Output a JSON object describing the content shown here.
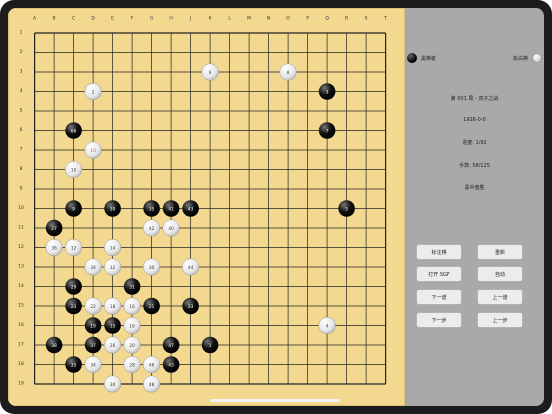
{
  "board": {
    "size": 19,
    "columns": [
      "A",
      "B",
      "C",
      "D",
      "E",
      "F",
      "G",
      "H",
      "J",
      "K",
      "L",
      "M",
      "N",
      "O",
      "P",
      "Q",
      "R",
      "S",
      "T"
    ],
    "rows": [
      "1",
      "2",
      "3",
      "4",
      "5",
      "6",
      "7",
      "8",
      "9",
      "10",
      "11",
      "12",
      "13",
      "14",
      "15",
      "16",
      "17",
      "18",
      "19"
    ],
    "stones": [
      {
        "color": "white",
        "col": 10,
        "row": 3,
        "label": "6"
      },
      {
        "color": "white",
        "col": 14,
        "row": 3,
        "label": "8"
      },
      {
        "color": "white",
        "col": 4,
        "row": 4,
        "label": "2"
      },
      {
        "color": "black",
        "col": 16,
        "row": 4,
        "label": "3"
      },
      {
        "color": "black",
        "col": 3,
        "row": 6,
        "label": "66"
      },
      {
        "color": "black",
        "col": 16,
        "row": 6,
        "label": "7"
      },
      {
        "color": "white",
        "col": 4,
        "row": 7,
        "label": "10",
        "label_color": "#e05050"
      },
      {
        "color": "white",
        "col": 3,
        "row": 8,
        "label": "10"
      },
      {
        "color": "black",
        "col": 3,
        "row": 10,
        "label": "9"
      },
      {
        "color": "black",
        "col": 5,
        "row": 10,
        "label": "39"
      },
      {
        "color": "black",
        "col": 7,
        "row": 10,
        "label": "35"
      },
      {
        "color": "black",
        "col": 8,
        "row": 10,
        "label": "41"
      },
      {
        "color": "black",
        "col": 9,
        "row": 10,
        "label": "43"
      },
      {
        "color": "black",
        "col": 17,
        "row": 10,
        "label": "5"
      },
      {
        "color": "black",
        "col": 2,
        "row": 11,
        "label": "27"
      },
      {
        "color": "white",
        "col": 7,
        "row": 11,
        "label": "42"
      },
      {
        "color": "white",
        "col": 8,
        "row": 11,
        "label": "40"
      },
      {
        "color": "white",
        "col": 2,
        "row": 12,
        "label": "36"
      },
      {
        "color": "white",
        "col": 3,
        "row": 12,
        "label": "12"
      },
      {
        "color": "white",
        "col": 5,
        "row": 12,
        "label": "14"
      },
      {
        "color": "white",
        "col": 4,
        "row": 13,
        "label": "34"
      },
      {
        "color": "white",
        "col": 5,
        "row": 13,
        "label": "32"
      },
      {
        "color": "white",
        "col": 7,
        "row": 13,
        "label": "30"
      },
      {
        "color": "white",
        "col": 9,
        "row": 13,
        "label": "44"
      },
      {
        "color": "black",
        "col": 3,
        "row": 14,
        "label": "29"
      },
      {
        "color": "black",
        "col": 6,
        "row": 14,
        "label": "31"
      },
      {
        "color": "black",
        "col": 3,
        "row": 15,
        "label": "23"
      },
      {
        "color": "white",
        "col": 4,
        "row": 15,
        "label": "22"
      },
      {
        "color": "white",
        "col": 5,
        "row": 15,
        "label": "18"
      },
      {
        "color": "white",
        "col": 6,
        "row": 15,
        "label": "16"
      },
      {
        "color": "black",
        "col": 7,
        "row": 15,
        "label": "21"
      },
      {
        "color": "black",
        "col": 9,
        "row": 15,
        "label": "33"
      },
      {
        "color": "black",
        "col": 4,
        "row": 16,
        "label": "19"
      },
      {
        "color": "black",
        "col": 5,
        "row": 16,
        "label": "15"
      },
      {
        "color": "white",
        "col": 6,
        "row": 16,
        "label": "16"
      },
      {
        "color": "white",
        "col": 16,
        "row": 16,
        "label": "4"
      },
      {
        "color": "black",
        "col": 2,
        "row": 17,
        "label": "38"
      },
      {
        "color": "black",
        "col": 4,
        "row": 17,
        "label": "37"
      },
      {
        "color": "white",
        "col": 5,
        "row": 17,
        "label": "26"
      },
      {
        "color": "white",
        "col": 6,
        "row": 17,
        "label": "20"
      },
      {
        "color": "black",
        "col": 8,
        "row": 17,
        "label": "47"
      },
      {
        "color": "black",
        "col": 10,
        "row": 17,
        "label": "1"
      },
      {
        "color": "black",
        "col": 3,
        "row": 18,
        "label": "35"
      },
      {
        "color": "white",
        "col": 4,
        "row": 18,
        "label": "34"
      },
      {
        "color": "white",
        "col": 6,
        "row": 18,
        "label": "28"
      },
      {
        "color": "white",
        "col": 7,
        "row": 18,
        "label": "46"
      },
      {
        "color": "black",
        "col": 8,
        "row": 18,
        "label": "43"
      },
      {
        "color": "white",
        "col": 5,
        "row": 19,
        "label": "30"
      },
      {
        "color": "white",
        "col": 7,
        "row": 19,
        "label": "48"
      }
    ]
  },
  "panel": {
    "black_player": "黑棋者",
    "white_player": "执白棋",
    "game_title": "第 001 局 - 双子之战",
    "date": "1926-0-0",
    "progress": "进度:  1/92",
    "moves": "手数:  58/125",
    "result": "黑中盘胜",
    "buttons": {
      "mark": "标注棋",
      "reset": "重新",
      "open_sgf": "打开 SGF",
      "auto": "自动",
      "next_move": "下一谱",
      "prev_move": "上一谱",
      "next_step": "下一步",
      "prev_step": "上一步"
    }
  },
  "colors": {
    "board": "#f2d98f",
    "grid": "#222222",
    "panel_bg": "#a9a9a9"
  }
}
